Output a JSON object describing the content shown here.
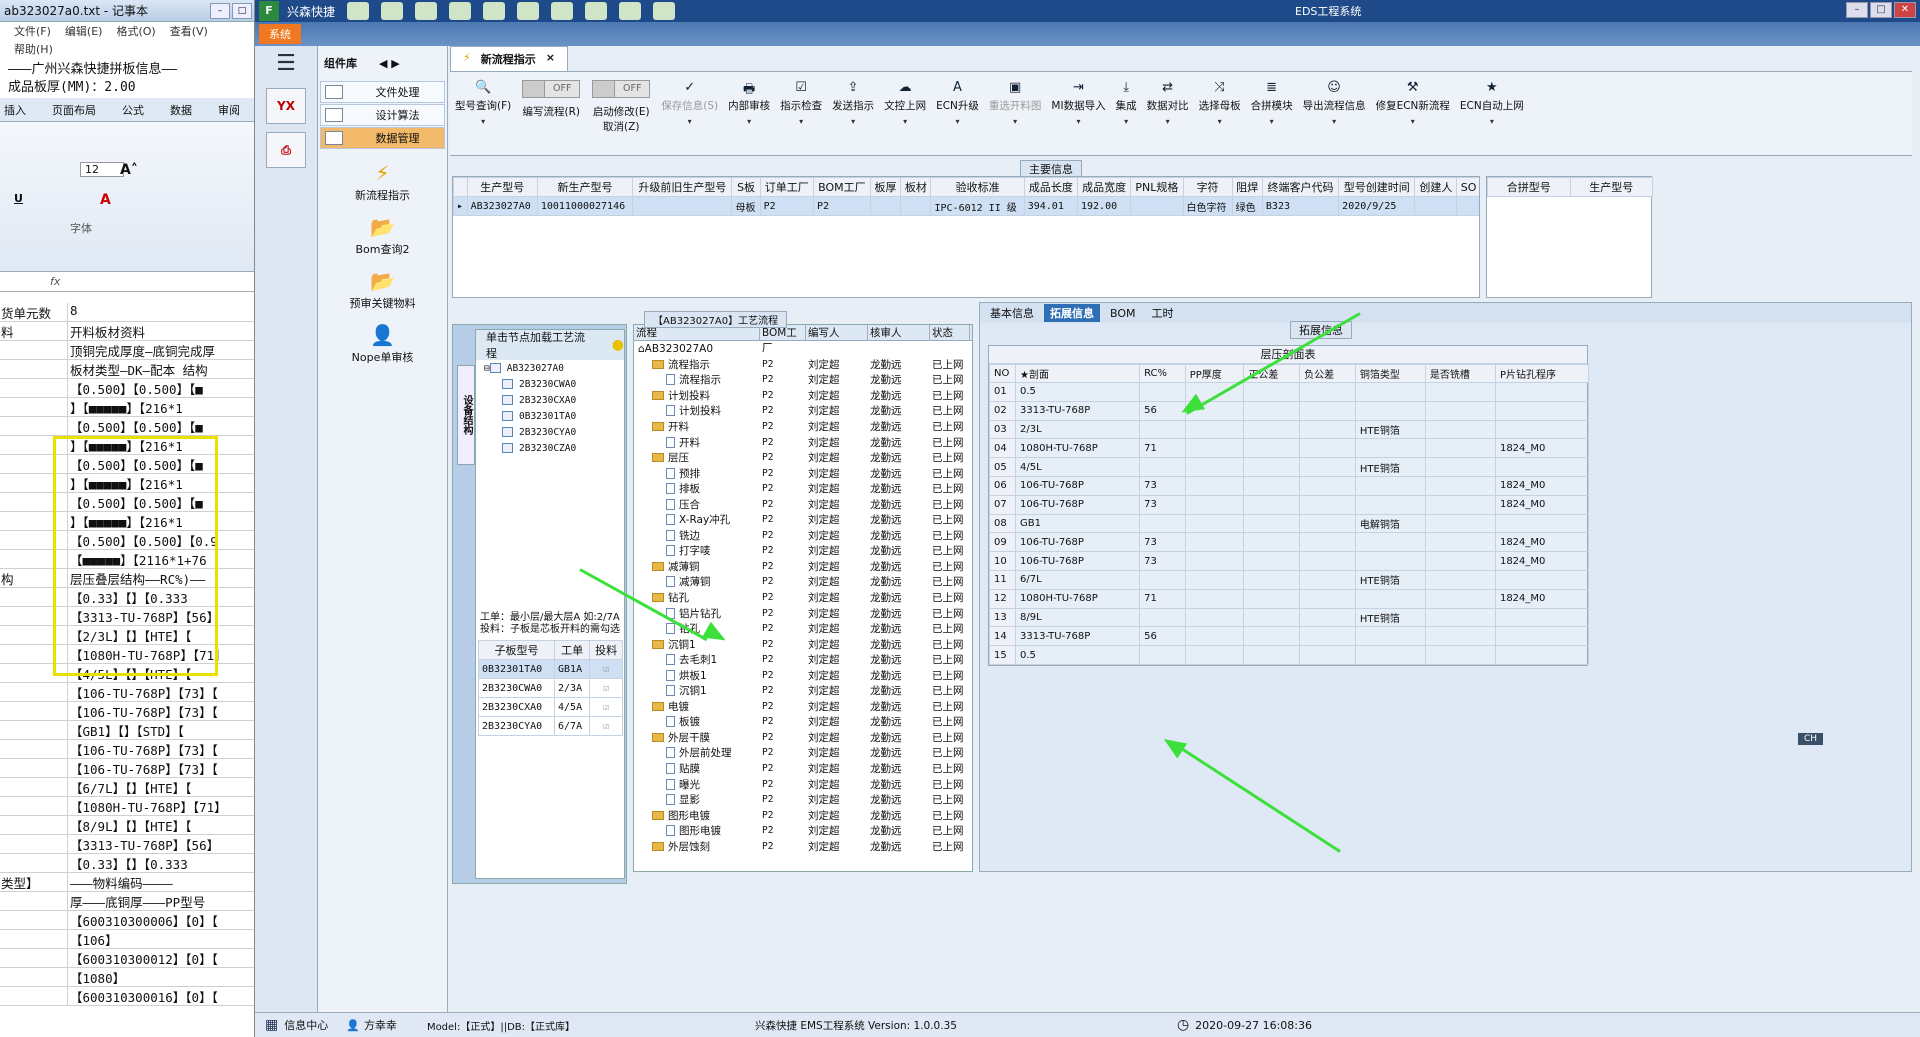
{
  "notepad": {
    "title": "ab323027a0.txt - 记事本",
    "menu": [
      "文件(F)",
      "编辑(E)",
      "格式(O)",
      "查看(V)"
    ],
    "menu2": "帮助(H)",
    "line1": "———广州兴森快捷拼板信息——",
    "line2": "成品板厚(MM)：2.00"
  },
  "excel": {
    "tabs": [
      "插入",
      "页面布局",
      "公式",
      "数据",
      "审阅"
    ],
    "font_size": "12",
    "font_group": "字体",
    "rows": [
      {
        "a": "货单元数",
        "b": "8"
      },
      {
        "a": "料",
        "b": "开料板材资料"
      },
      {
        "a": "",
        "b": "顶铜完成厚度—底铜完成厚"
      },
      {
        "a": "",
        "b": "板材类型—DK—配本 结构"
      },
      {
        "a": "",
        "b": "【0.500】【0.500】【■"
      },
      {
        "a": "",
        "b": "】【■■■■■】【216*1"
      },
      {
        "a": "",
        "b": "【0.500】【0.500】【■"
      },
      {
        "a": "",
        "b": "】【■■■■■】【216*1"
      },
      {
        "a": "",
        "b": "【0.500】【0.500】【■"
      },
      {
        "a": "",
        "b": "】【■■■■■】【216*1"
      },
      {
        "a": "",
        "b": "【0.500】【0.500】【■"
      },
      {
        "a": "",
        "b": "】【■■■■■】【216*1"
      },
      {
        "a": "",
        "b": "【0.500】【0.500】【0.9"
      },
      {
        "a": "",
        "b": "【■■■■■】【2116*1+76"
      },
      {
        "a": "构",
        "b": "层压叠层结构——RC%)——"
      },
      {
        "a": "",
        "b": "【0.33】【】【0.333"
      },
      {
        "a": "",
        "b": "【3313-TU-768P】【56】"
      },
      {
        "a": "",
        "b": "【2/3L】【】【HTE】【"
      },
      {
        "a": "",
        "b": "【1080H-TU-768P】【71】"
      },
      {
        "a": "",
        "b": "【4/5L】【】【HTE】【"
      },
      {
        "a": "",
        "b": "【106-TU-768P】【73】【"
      },
      {
        "a": "",
        "b": "【106-TU-768P】【73】【"
      },
      {
        "a": "",
        "b": "【GB1】【】【STD】【"
      },
      {
        "a": "",
        "b": "【106-TU-768P】【73】【"
      },
      {
        "a": "",
        "b": "【106-TU-768P】【73】【"
      },
      {
        "a": "",
        "b": "【6/7L】【】【HTE】【"
      },
      {
        "a": "",
        "b": "【1080H-TU-768P】【71】"
      },
      {
        "a": "",
        "b": "【8/9L】【】【HTE】【"
      },
      {
        "a": "",
        "b": "【3313-TU-768P】【56】"
      },
      {
        "a": "",
        "b": "【0.33】【】【0.333"
      },
      {
        "a": "类型】",
        "b": "———物料编码————"
      },
      {
        "a": "",
        "b": "厚———底铜厚———PP型号"
      },
      {
        "a": "",
        "b": "【600310300006】【0】【"
      },
      {
        "a": "",
        "b": "【106】"
      },
      {
        "a": "",
        "b": "【600310300012】【0】【"
      },
      {
        "a": "",
        "b": "【1080】"
      },
      {
        "a": "",
        "b": "【600310300016】【0】【"
      }
    ]
  },
  "app": {
    "title": "兴森快捷",
    "caption": "EDS工程系统",
    "system_tab": "系统",
    "nav": {
      "components": "组件库",
      "items": [
        "文件处理",
        "设计算法",
        "数据管理"
      ],
      "big": [
        "新流程指示",
        "Bom查询2",
        "预审关键物料",
        "Nope单审核"
      ]
    },
    "doc_tab": "新流程指示",
    "toolbar": [
      {
        "icon": "🔍",
        "label": "型号查询(F)",
        "dis": false
      },
      {
        "toggle": true,
        "label": "编写流程(R)",
        "state": "OFF"
      },
      {
        "toggle": true,
        "label": "启动修改(E)",
        "sub": "取消(Z)",
        "state": "OFF"
      },
      {
        "icon": "✓",
        "label": "保存信息(S)",
        "dis": true
      },
      {
        "icon": "🖶",
        "label": "内部审核",
        "dis": false
      },
      {
        "icon": "☑",
        "label": "指示检查",
        "dis": false
      },
      {
        "icon": "⇪",
        "label": "发送指示",
        "dis": false
      },
      {
        "icon": "☁",
        "label": "文控上网",
        "dis": false
      },
      {
        "icon": "A",
        "label": "ECN升级",
        "dis": false
      },
      {
        "icon": "▣",
        "label": "重选开料图",
        "dis": true
      },
      {
        "icon": "⇥",
        "label": "MI数据导入",
        "dis": false
      },
      {
        "icon": "⤓",
        "label": "集成",
        "dis": false
      },
      {
        "icon": "⇄",
        "label": "数据对比",
        "dis": false
      },
      {
        "icon": "⤨",
        "label": "选择母板",
        "dis": false
      },
      {
        "icon": "≣",
        "label": "合拼模块",
        "dis": false
      },
      {
        "icon": "☺",
        "label": "导出流程信息",
        "dis": false
      },
      {
        "icon": "⚒",
        "label": "修复ECN新流程",
        "dis": false
      },
      {
        "icon": "★",
        "label": "ECN自动上网",
        "dis": false
      }
    ],
    "main_info": {
      "section": "主要信息",
      "headers": [
        "生产型号",
        "新生产型号",
        "升级前旧生产型号",
        "S板",
        "订单工厂",
        "BOM工厂",
        "板厚",
        "板材",
        "验收标准",
        "成品长度",
        "成品宽度",
        "PNL规格",
        "字符",
        "阻焊",
        "终端客户代码",
        "型号创建时间",
        "创建人",
        "SO"
      ],
      "row": [
        "AB323027A0",
        "10011000027146",
        "",
        "母板",
        "P2",
        "P2",
        "",
        "",
        "IPC-6012 II 级",
        "394.01",
        "192.00",
        "",
        "白色字符",
        "绿色",
        "B323",
        "2020/9/25",
        "",
        ""
      ],
      "side_headers": [
        "合拼型号",
        "生产型号"
      ]
    },
    "nav_tree": {
      "title": "单击节点加载工艺流程",
      "side": "设备结构",
      "root": "AB323027A0",
      "children": [
        "2B3230CWA0",
        "2B3230CXA0",
        "0B32301TA0",
        "2B3230CYA0",
        "2B3230CZA0"
      ],
      "note1": "工单：最小层/最大层A 如:2/7A",
      "note2": "投料：子板是芯板开料的需勾选",
      "sub_headers": [
        "子板型号",
        "工单",
        "投料"
      ],
      "sub_rows": [
        [
          "0B32301TA0",
          "GB1A"
        ],
        [
          "2B3230CWA0",
          "2/3A"
        ],
        [
          "2B3230CXA0",
          "4/5A"
        ],
        [
          "2B3230CYA0",
          "6/7A"
        ]
      ]
    },
    "flow": {
      "title": "【AB323027A0】工艺流程",
      "headers": [
        "流程",
        "BOM工厂",
        "编写人",
        "核审人",
        "状态"
      ],
      "rows": [
        {
          "n": "AB323027A0",
          "lv": 0,
          "k": "root"
        },
        {
          "n": "流程指示",
          "lv": 1,
          "k": "f"
        },
        {
          "n": "流程指示",
          "lv": 2,
          "k": "l"
        },
        {
          "n": "计划投料",
          "lv": 1,
          "k": "f"
        },
        {
          "n": "计划投料",
          "lv": 2,
          "k": "l"
        },
        {
          "n": "开料",
          "lv": 1,
          "k": "f"
        },
        {
          "n": "开料",
          "lv": 2,
          "k": "l"
        },
        {
          "n": "层压",
          "lv": 1,
          "k": "f"
        },
        {
          "n": "预排",
          "lv": 2,
          "k": "l"
        },
        {
          "n": "排板",
          "lv": 2,
          "k": "l"
        },
        {
          "n": "压合",
          "lv": 2,
          "k": "l"
        },
        {
          "n": "X-Ray冲孔",
          "lv": 2,
          "k": "l"
        },
        {
          "n": "铣边",
          "lv": 2,
          "k": "l"
        },
        {
          "n": "打字唛",
          "lv": 2,
          "k": "l"
        },
        {
          "n": "减薄铜",
          "lv": 1,
          "k": "f"
        },
        {
          "n": "减薄铜",
          "lv": 2,
          "k": "l"
        },
        {
          "n": "钻孔",
          "lv": 1,
          "k": "f"
        },
        {
          "n": "铝片钻孔",
          "lv": 2,
          "k": "l"
        },
        {
          "n": "钻孔",
          "lv": 2,
          "k": "l"
        },
        {
          "n": "沉铜1",
          "lv": 1,
          "k": "f"
        },
        {
          "n": "去毛刺1",
          "lv": 2,
          "k": "l"
        },
        {
          "n": "烘板1",
          "lv": 2,
          "k": "l"
        },
        {
          "n": "沉铜1",
          "lv": 2,
          "k": "l"
        },
        {
          "n": "电镀",
          "lv": 1,
          "k": "f"
        },
        {
          "n": "板镀",
          "lv": 2,
          "k": "l"
        },
        {
          "n": "外层干膜",
          "lv": 1,
          "k": "f"
        },
        {
          "n": "外层前处理",
          "lv": 2,
          "k": "l"
        },
        {
          "n": "贴膜",
          "lv": 2,
          "k": "l"
        },
        {
          "n": "曝光",
          "lv": 2,
          "k": "l"
        },
        {
          "n": "显影",
          "lv": 2,
          "k": "l"
        },
        {
          "n": "图形电镀",
          "lv": 1,
          "k": "f"
        },
        {
          "n": "图形电镀",
          "lv": 2,
          "k": "l"
        },
        {
          "n": "外层蚀刻",
          "lv": 1,
          "k": "f"
        }
      ],
      "bom": "P2",
      "writer": "刘定超",
      "reviewer": "龙勤远",
      "status": "已上网"
    },
    "right": {
      "tabs": [
        "基本信息",
        "拓展信息",
        "BOM",
        "工时"
      ],
      "section": "拓展信息",
      "table_title": "层压剖面表",
      "headers": [
        "NO",
        "★剖面",
        "RC%",
        "PP厚度",
        "正公差",
        "负公差",
        "铜箔类型",
        "是否铣槽",
        "P片钻孔程序"
      ],
      "rows": [
        [
          "01",
          "0.5",
          "",
          "",
          "",
          "",
          "",
          "",
          ""
        ],
        [
          "02",
          "3313-TU-768P",
          "56",
          "",
          "",
          "",
          "",
          "",
          ""
        ],
        [
          "03",
          "2/3L",
          "",
          "",
          "",
          "",
          "HTE铜箔",
          "",
          ""
        ],
        [
          "04",
          "1080H-TU-768P",
          "71",
          "",
          "",
          "",
          "",
          "",
          "1824_M0"
        ],
        [
          "05",
          "4/5L",
          "",
          "",
          "",
          "",
          "HTE铜箔",
          "",
          ""
        ],
        [
          "06",
          "106-TU-768P",
          "73",
          "",
          "",
          "",
          "",
          "",
          "1824_M0"
        ],
        [
          "07",
          "106-TU-768P",
          "73",
          "",
          "",
          "",
          "",
          "",
          "1824_M0"
        ],
        [
          "08",
          "GB1",
          "",
          "",
          "",
          "",
          "电解铜箔",
          "",
          ""
        ],
        [
          "09",
          "106-TU-768P",
          "73",
          "",
          "",
          "",
          "",
          "",
          "1824_M0"
        ],
        [
          "10",
          "106-TU-768P",
          "73",
          "",
          "",
          "",
          "",
          "",
          "1824_M0"
        ],
        [
          "11",
          "6/7L",
          "",
          "",
          "",
          "",
          "HTE铜箔",
          "",
          ""
        ],
        [
          "12",
          "1080H-TU-768P",
          "71",
          "",
          "",
          "",
          "",
          "",
          "1824_M0"
        ],
        [
          "13",
          "8/9L",
          "",
          "",
          "",
          "",
          "HTE铜箔",
          "",
          ""
        ],
        [
          "14",
          "3313-TU-768P",
          "56",
          "",
          "",
          "",
          "",
          "",
          ""
        ],
        [
          "15",
          "0.5",
          "",
          "",
          "",
          "",
          "",
          "",
          ""
        ]
      ]
    },
    "status": {
      "info": "信息中心",
      "user": "方幸幸",
      "model": "Model:【正式】||DB:【正式库】",
      "version": "兴森快捷 EMS工程系统 Version: 1.0.0.35",
      "time": "2020-09-27 16:08:36",
      "lang": "CH"
    }
  }
}
